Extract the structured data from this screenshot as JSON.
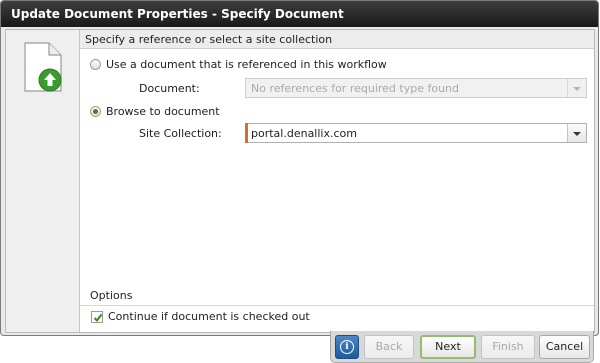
{
  "dialog": {
    "title": "Update Document Properties - Specify Document"
  },
  "section": {
    "header": "Specify a reference or select a site collection"
  },
  "reference_option": {
    "label": "Use a document that is referenced in this workflow",
    "document_label": "Document:",
    "document_placeholder": "No references for required type found",
    "selected": false
  },
  "browse_option": {
    "label": "Browse to document",
    "site_collection_label": "Site Collection:",
    "site_collection_value": "portal.denallix.com",
    "selected": true
  },
  "options": {
    "header": "Options",
    "continue_if_checked_out_label": "Continue if document is checked out",
    "continue_if_checked_out_checked": true
  },
  "buttons": {
    "info_icon": "info-icon",
    "back": "Back",
    "next": "Next",
    "finish": "Finish",
    "cancel": "Cancel"
  },
  "colors": {
    "accent_green": "#3f8a12",
    "title_bar": "#1e1e1e",
    "info_blue": "#2a66ad"
  }
}
